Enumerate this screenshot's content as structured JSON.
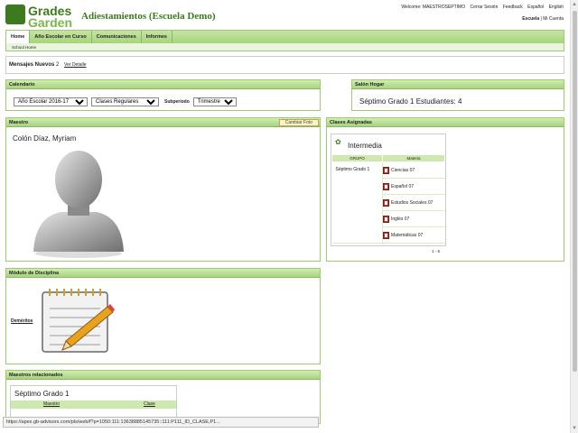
{
  "logo": {
    "line1": "Grades",
    "line2": "Garden"
  },
  "school_title": "Adiestamientos (Escuela Demo)",
  "top_links": [
    "Welcome: MAESTROSEPTIMO",
    "Cerrar Sesión",
    "Feedback",
    "Español",
    "English"
  ],
  "sub_links": {
    "escuela": "Escuela",
    "sep": "|",
    "mi_cuenta": "Mi Cuenta"
  },
  "nav": {
    "tabs": [
      "Home",
      "Año Escolar en Curso",
      "Comunicaciones",
      "Informes"
    ],
    "breadcrumb": "School Home"
  },
  "messages": {
    "label": "Mensajes Nuevos",
    "count": "2",
    "link": "Ver Detalle"
  },
  "calendario": {
    "title": "Calendario",
    "year": "Año Escolar 2016-17",
    "type": "Clases Regulares",
    "subperiod_label": "Subperíodo",
    "subperiod": "Trimestre 3"
  },
  "salon": {
    "title": "Salón Hogar",
    "text": "Séptimo Grado 1  Estudiantes: 4"
  },
  "maestro": {
    "title": "Maestro",
    "change_photo": "Cambiar Foto",
    "name": "Colón Díaz, Myriam"
  },
  "clases": {
    "title": "Clases Asignadas",
    "level": "Intermedia",
    "col_group": "GRUPO",
    "col_subject": "Materia",
    "group": "Séptimo Grado 1",
    "subjects": [
      "Ciencias 07",
      "Español 07",
      "Estudios Sociales 07",
      "Inglés 07",
      "Matemáticas 07"
    ],
    "pager": "1 - 5"
  },
  "disciplina": {
    "title": "Módulo de Disciplina",
    "link": "Deméritos"
  },
  "relacionados": {
    "title": "Maestros relacionados",
    "group": "Séptimo Grado 1",
    "col_teacher": "Maestro",
    "col_class": "Clase"
  },
  "status_url": "https://apex.gb-advisors.com/pls/web/f?p=1050:111:13638885145735::111:P111_ID_CLASE,P1..."
}
